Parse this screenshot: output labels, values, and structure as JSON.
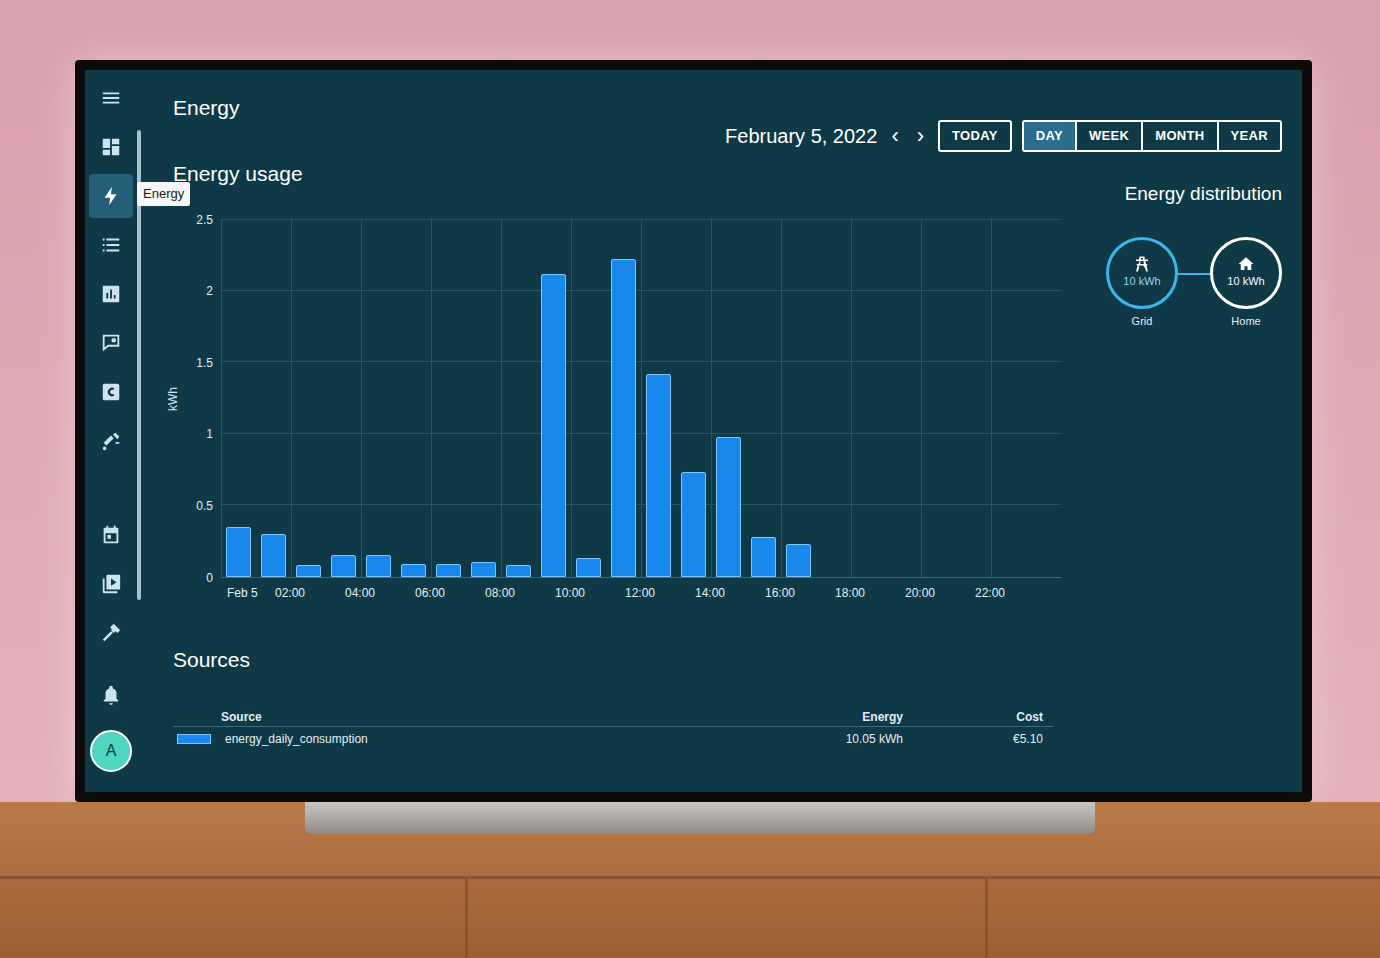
{
  "header": {
    "title": "Energy",
    "date": "February 5, 2022",
    "prev": "‹",
    "next": "›",
    "today": "TODAY"
  },
  "periods": [
    {
      "label": "DAY",
      "selected": true
    },
    {
      "label": "WEEK",
      "selected": false
    },
    {
      "label": "MONTH",
      "selected": false
    },
    {
      "label": "YEAR",
      "selected": false
    }
  ],
  "sidebar": {
    "items": [
      {
        "selected": false
      },
      {
        "selected": false
      },
      {
        "selected": true
      },
      {
        "selected": false
      },
      {
        "selected": false
      },
      {
        "selected": false
      },
      {
        "selected": false
      },
      {
        "selected": false
      },
      {
        "selected": false
      },
      {
        "selected": false
      },
      {
        "selected": false
      },
      {
        "selected": false
      }
    ],
    "tooltip": "Energy",
    "avatar": "A"
  },
  "chart": {
    "title": "Energy usage",
    "unit": "kWh",
    "y_ticks": [
      "0",
      "0.5",
      "1",
      "1.5",
      "2",
      "2.5"
    ],
    "x_labels": [
      "Feb 5",
      "02:00",
      "04:00",
      "06:00",
      "08:00",
      "10:00",
      "12:00",
      "14:00",
      "16:00",
      "18:00",
      "20:00",
      "22:00"
    ],
    "series": [
      {
        "name": "energy",
        "values": [
          0.35,
          0.3,
          0.08,
          0.15,
          0.15,
          0.09,
          0.09,
          0.1,
          0.08,
          2.12,
          0.13,
          2.22,
          1.42,
          0.73,
          0.98,
          0.28,
          0.23
        ]
      }
    ]
  },
  "distribution": {
    "title": "Energy distribution",
    "grid": {
      "value": "10 kWh",
      "label": "Grid"
    },
    "home": {
      "value": "10 kWh",
      "label": "Home"
    }
  },
  "sources": {
    "title": "Sources",
    "columns": [
      "Source",
      "Energy",
      "Cost"
    ],
    "rows": [
      [
        "energy_daily_consumption",
        "10.05 kWh",
        "€5.10"
      ]
    ]
  }
}
